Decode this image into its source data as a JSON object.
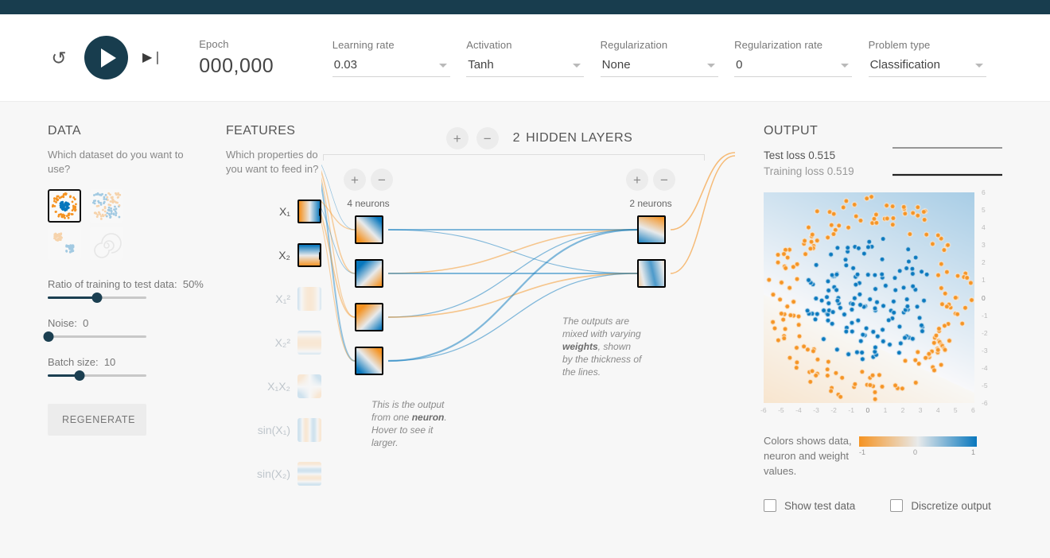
{
  "toolbar": {
    "reset_icon": "reset-icon",
    "play_icon": "play-icon",
    "step_icon": "step-forward-icon",
    "epoch_label": "Epoch",
    "epoch_value": "000,000",
    "controls": [
      {
        "label": "Learning rate",
        "value": "0.03"
      },
      {
        "label": "Activation",
        "value": "Tanh"
      },
      {
        "label": "Regularization",
        "value": "None"
      },
      {
        "label": "Regularization rate",
        "value": "0"
      },
      {
        "label": "Problem type",
        "value": "Classification"
      }
    ]
  },
  "data_panel": {
    "title": "DATA",
    "subtitle": "Which dataset do you want to use?",
    "datasets": [
      {
        "name": "circle",
        "selected": true
      },
      {
        "name": "exclusive-or",
        "selected": false
      },
      {
        "name": "gaussian",
        "selected": false
      },
      {
        "name": "spiral",
        "selected": false
      }
    ],
    "ratio_label": "Ratio of training to test data:",
    "ratio_value": "50%",
    "ratio_pct": 50,
    "noise_label": "Noise:",
    "noise_value": "0",
    "noise_pct": 0,
    "batch_label": "Batch size:",
    "batch_value": "10",
    "batch_pct": 32,
    "regenerate_label": "REGENERATE"
  },
  "features_panel": {
    "title": "FEATURES",
    "subtitle": "Which properties do you want to feed in?",
    "features": [
      {
        "label": "X₁",
        "name": "feature-x1",
        "active": true,
        "pattern": "vertical-split"
      },
      {
        "label": "X₂",
        "name": "feature-x2",
        "active": true,
        "pattern": "horizontal-split"
      },
      {
        "label": "X₁²",
        "name": "feature-x1-squared",
        "active": false,
        "pattern": "vertical-bands"
      },
      {
        "label": "X₂²",
        "name": "feature-x2-squared",
        "active": false,
        "pattern": "horizontal-bands"
      },
      {
        "label": "X₁X₂",
        "name": "feature-x1x2",
        "active": false,
        "pattern": "quadrants"
      },
      {
        "label": "sin(X₁)",
        "name": "feature-sin-x1",
        "active": false,
        "pattern": "sine-vertical"
      },
      {
        "label": "sin(X₂)",
        "name": "feature-sin-x2",
        "active": false,
        "pattern": "sine-horizontal"
      }
    ]
  },
  "network_panel": {
    "layer_count": "2",
    "layers_label": "HIDDEN LAYERS",
    "add_layer_icon": "plus-icon",
    "remove_layer_icon": "minus-icon",
    "layers": [
      {
        "neuron_count_label": "4 neurons",
        "neurons": 4
      },
      {
        "neuron_count_label": "2 neurons",
        "neurons": 2
      }
    ],
    "annotation_neuron": "This is the output from one neuron. Hover to see it larger.",
    "annotation_neuron_parts": {
      "a": "This is the output from one ",
      "b": "neuron",
      "c": ". Hover to see it larger."
    },
    "annotation_weights_parts": {
      "a": "The outputs are mixed with varying ",
      "b": "weights",
      "c": ", shown by the thickness of the lines."
    }
  },
  "output_panel": {
    "title": "OUTPUT",
    "test_loss_label": "Test loss",
    "test_loss_value": "0.515",
    "training_loss_label": "Training loss",
    "training_loss_value": "0.519",
    "legend_text": "Colors shows data, neuron and weight values.",
    "legend_min": "-1",
    "legend_mid": "0",
    "legend_max": "1",
    "checkbox_show_test_data": "Show test data",
    "checkbox_discretize_output": "Discretize output",
    "axis_x_ticks": [
      "-6",
      "-5",
      "-4",
      "-3",
      "-2",
      "-1",
      "0",
      "1",
      "2",
      "3",
      "4",
      "5",
      "6"
    ],
    "axis_y_ticks": [
      "6",
      "5",
      "4",
      "3",
      "2",
      "1",
      "0",
      "-1",
      "-2",
      "-3",
      "-4",
      "-5",
      "-6"
    ]
  },
  "colors": {
    "negative": "#f59322",
    "positive": "#0877bd",
    "neutral": "#e8eaeb",
    "brand_dark": "#183d4e",
    "page_bg": "#f7f7f7"
  },
  "chart_data": {
    "type": "line",
    "title": "Loss history",
    "series": [
      {
        "name": "Test loss",
        "values": [
          0.515,
          0.515
        ],
        "color": "#777777"
      },
      {
        "name": "Training loss",
        "values": [
          0.519,
          0.519
        ],
        "color": "#222222"
      }
    ],
    "x": [
      0,
      1
    ],
    "ylim": [
      0,
      1
    ],
    "grid": false,
    "legend": "none"
  }
}
